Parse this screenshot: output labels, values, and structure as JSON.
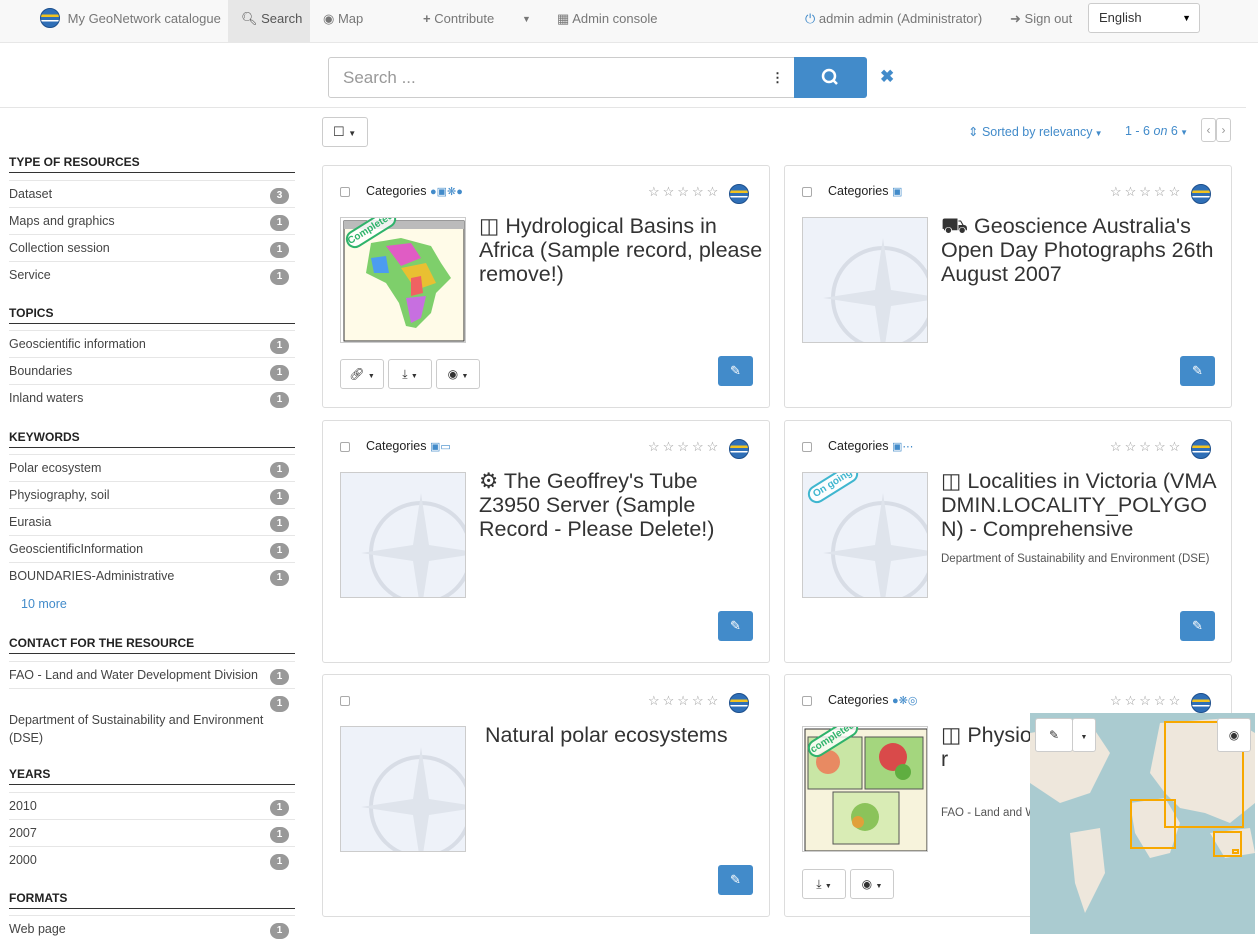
{
  "nav": {
    "brand": "My GeoNetwork catalogue",
    "search": "Search",
    "map": "Map",
    "contribute": "Contribute",
    "admin_console": "Admin console",
    "user": "admin admin (Administrator)",
    "sign_out": "Sign out",
    "language": "English"
  },
  "search": {
    "placeholder": "Search ...",
    "options_icon": "⋮"
  },
  "facets": [
    {
      "title": "TYPE OF RESOURCES",
      "items": [
        {
          "label": "Dataset",
          "count": "3"
        },
        {
          "label": "Maps and graphics",
          "count": "1"
        },
        {
          "label": "Collection session",
          "count": "1"
        },
        {
          "label": "Service",
          "count": "1"
        }
      ]
    },
    {
      "title": "TOPICS",
      "items": [
        {
          "label": "Geoscientific information",
          "count": "1"
        },
        {
          "label": "Boundaries",
          "count": "1"
        },
        {
          "label": "Inland waters",
          "count": "1"
        }
      ]
    },
    {
      "title": "KEYWORDS",
      "items": [
        {
          "label": "Polar ecosystem",
          "count": "1"
        },
        {
          "label": "Physiography, soil",
          "count": "1"
        },
        {
          "label": "Eurasia",
          "count": "1"
        },
        {
          "label": "GeoscientificInformation",
          "count": "1"
        },
        {
          "label": "BOUNDARIES-Administrative",
          "count": "1"
        }
      ],
      "more": "10 more"
    },
    {
      "title": "CONTACT FOR THE RESOURCE",
      "items": [
        {
          "label": "FAO - Land and Water Development Division",
          "count": "1"
        },
        {
          "label": "Department of Sustainability and Environment (DSE)",
          "count": "1"
        }
      ]
    },
    {
      "title": "YEARS",
      "items": [
        {
          "label": "2010",
          "count": "1"
        },
        {
          "label": "2007",
          "count": "1"
        },
        {
          "label": "2000",
          "count": "1"
        }
      ]
    },
    {
      "title": "FORMATS",
      "items": [
        {
          "label": "Web page",
          "count": "1"
        }
      ]
    }
  ],
  "results": {
    "sort": "Sorted by relevancy",
    "range": "1 - 6",
    "on_word": "on",
    "total": "6"
  },
  "records": [
    {
      "categories": "Categories",
      "title": "Hydrological Basins in Africa (Sample record, please remove!)",
      "org": "",
      "status": "Completed",
      "type_icon": "database-icon"
    },
    {
      "categories": "Categories",
      "title": "Geoscience Australia's Open Day Photographs 26th August 2007",
      "org": "",
      "status": "",
      "type_icon": "truck-icon"
    },
    {
      "categories": "Categories",
      "title": "The Geoffrey's Tube Z3950 Server (Sample Record - Please Delete!)",
      "org": "",
      "status": "",
      "type_icon": "gear-icon"
    },
    {
      "categories": "Categories",
      "title": "Localities in Victoria (VMADMIN.LOCALITY_POLYGON) - Comprehensive",
      "org": "Department of Sustainability and Environment (DSE)",
      "status": "On going",
      "type_icon": "database-icon"
    },
    {
      "categories": "",
      "title": "Natural polar ecosystems",
      "org": "",
      "status": "",
      "type_icon": ""
    },
    {
      "categories": "Categories",
      "title": "Physio North and (Sample r",
      "org": "FAO - Land and W",
      "status": "completed",
      "type_icon": "database-icon"
    }
  ],
  "colors": {
    "accent": "#428bca",
    "completed": "#2fb36b",
    "ongoing": "#3fb6cf",
    "bbox": "#f7a800"
  }
}
